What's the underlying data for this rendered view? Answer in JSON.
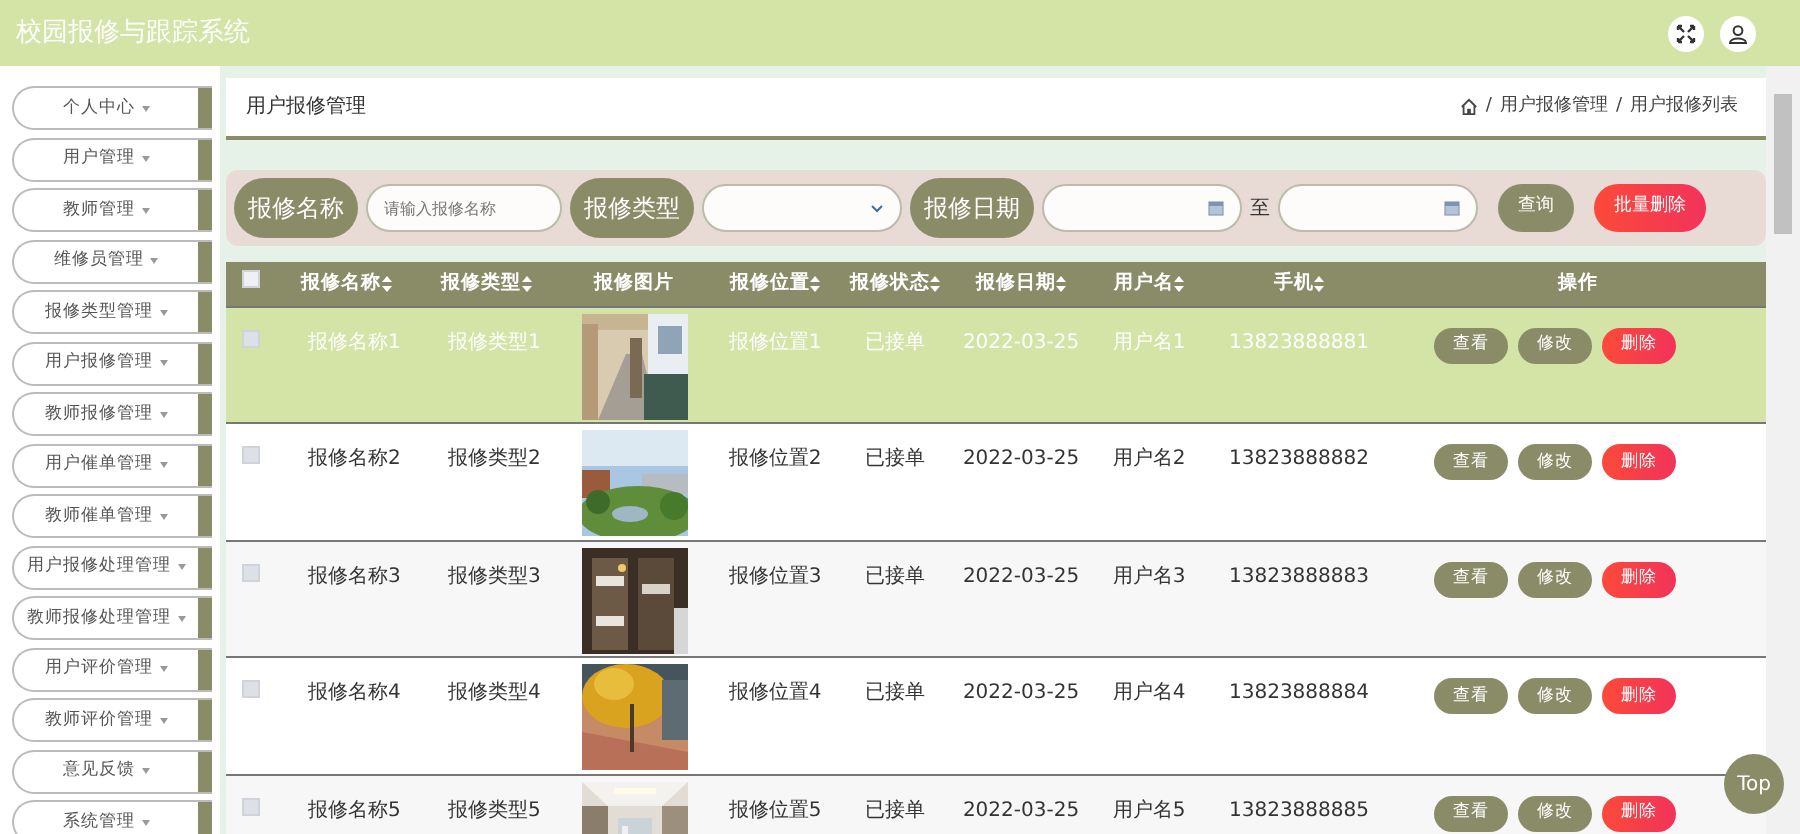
{
  "header": {
    "title": "校园报修与跟踪系统"
  },
  "sidebar": {
    "items": [
      {
        "label": "个人中心"
      },
      {
        "label": "用户管理"
      },
      {
        "label": "教师管理"
      },
      {
        "label": "维修员管理"
      },
      {
        "label": "报修类型管理"
      },
      {
        "label": "用户报修管理"
      },
      {
        "label": "教师报修管理"
      },
      {
        "label": "用户催单管理"
      },
      {
        "label": "教师催单管理"
      },
      {
        "label": "用户报修处理管理"
      },
      {
        "label": "教师报修处理管理"
      },
      {
        "label": "用户评价管理"
      },
      {
        "label": "教师评价管理"
      },
      {
        "label": "意见反馈"
      },
      {
        "label": "系统管理"
      }
    ]
  },
  "page_title": "用户报修管理",
  "breadcrumb_separator": "/",
  "breadcrumb": [
    "用户报修管理",
    "用户报修列表"
  ],
  "search": {
    "name_label": "报修名称",
    "name_placeholder": "请输入报修名称",
    "type_label": "报修类型",
    "date_label": "报修日期",
    "to": "至",
    "query_button": "查询",
    "batch_delete_button": "批量删除"
  },
  "table": {
    "columns": [
      {
        "label": "报修名称",
        "sortable": true
      },
      {
        "label": "报修类型",
        "sortable": true
      },
      {
        "label": "报修图片",
        "sortable": false
      },
      {
        "label": "报修位置",
        "sortable": true
      },
      {
        "label": "报修状态",
        "sortable": true
      },
      {
        "label": "报修日期",
        "sortable": true
      },
      {
        "label": "用户名",
        "sortable": true
      },
      {
        "label": "手机",
        "sortable": true
      },
      {
        "label": "操作",
        "sortable": false
      }
    ],
    "select_all_checked": false,
    "rows": [
      {
        "selected": true,
        "checked": false,
        "cells": [
          "报修名称1",
          "报修类型1",
          {
            "kind": "picture"
          },
          "报修位置1",
          "已接单",
          "2022-03-25",
          "用户名1",
          "13823888881"
        ],
        "actions": [
          "查看",
          "修改",
          "删除"
        ]
      },
      {
        "selected": false,
        "checked": false,
        "cells": [
          "报修名称2",
          "报修类型2",
          {
            "kind": "picture"
          },
          "报修位置2",
          "已接单",
          "2022-03-25",
          "用户名2",
          "13823888882"
        ],
        "actions": [
          "查看",
          "修改",
          "删除"
        ]
      },
      {
        "selected": false,
        "checked": false,
        "cells": [
          "报修名称3",
          "报修类型3",
          {
            "kind": "picture"
          },
          "报修位置3",
          "已接单",
          "2022-03-25",
          "用户名3",
          "13823888883"
        ],
        "actions": [
          "查看",
          "修改",
          "删除"
        ]
      },
      {
        "selected": false,
        "checked": false,
        "cells": [
          "报修名称4",
          "报修类型4",
          {
            "kind": "picture"
          },
          "报修位置4",
          "已接单",
          "2022-03-25",
          "用户名4",
          "13823888884"
        ],
        "actions": [
          "查看",
          "修改",
          "删除"
        ]
      },
      {
        "selected": false,
        "checked": false,
        "cells": [
          "报修名称5",
          "报修类型5",
          {
            "kind": "picture"
          },
          "报修位置5",
          "已接单",
          "2022-03-25",
          "用户名5",
          "13823888885"
        ],
        "actions": [
          "查看",
          "修改",
          "删除"
        ]
      }
    ]
  },
  "top_button": "Top"
}
